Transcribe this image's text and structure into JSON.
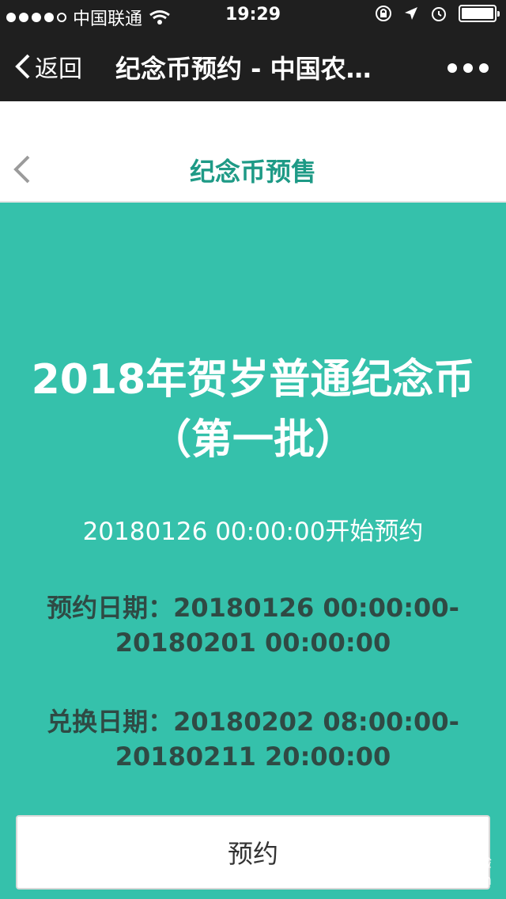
{
  "status_bar": {
    "carrier": "中国联通",
    "time": "19:29"
  },
  "nav": {
    "back_label": "返回",
    "title": "纪念币预约 - 中国农…"
  },
  "header": {
    "title": "纪念币预售"
  },
  "main": {
    "coin_title": "2018年贺岁普通纪念币（第一批）",
    "start_text": "20180126 00:00:00开始预约",
    "booking_date_line1": "预约日期：20180126 00:00:00-",
    "booking_date_line2": "20180201 00:00:00",
    "exchange_date_line1": "兑换日期：20180202 08:00:00-",
    "exchange_date_line2": "20180211 20:00:00",
    "reserve_button": "预约"
  },
  "watermark": {
    "brand": "Baidu 经验",
    "url": "jingyan.baidu.com"
  }
}
